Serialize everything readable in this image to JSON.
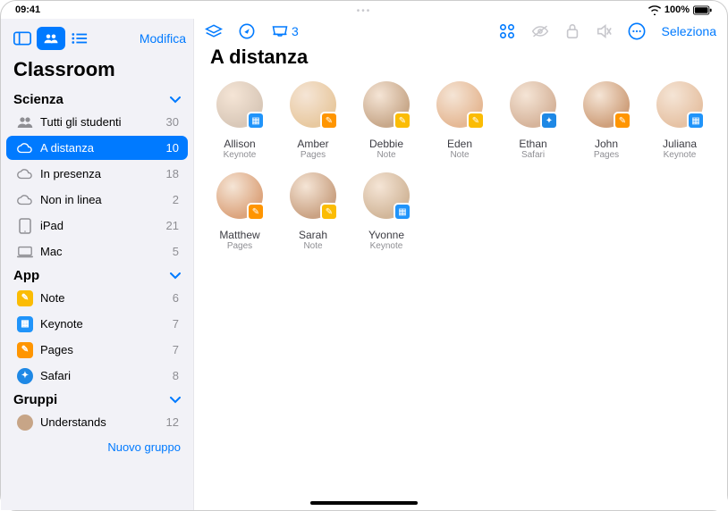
{
  "status": {
    "time": "09:41",
    "battery": "100%"
  },
  "sidebar": {
    "edit_label": "Modifica",
    "title": "Classroom",
    "sections": [
      {
        "header": "Scienza",
        "items": [
          {
            "icon": "people",
            "label": "Tutti gli studenti",
            "count": "30",
            "selected": false
          },
          {
            "icon": "cloud",
            "label": "A distanza",
            "count": "10",
            "selected": true
          },
          {
            "icon": "cloud",
            "label": "In presenza",
            "count": "18",
            "selected": false
          },
          {
            "icon": "cloud",
            "label": "Non in linea",
            "count": "2",
            "selected": false
          },
          {
            "icon": "ipad",
            "label": "iPad",
            "count": "21",
            "selected": false
          },
          {
            "icon": "mac",
            "label": "Mac",
            "count": "5",
            "selected": false
          }
        ]
      },
      {
        "header": "App",
        "items": [
          {
            "icon": "note",
            "label": "Note",
            "count": "6"
          },
          {
            "icon": "keynote",
            "label": "Keynote",
            "count": "7"
          },
          {
            "icon": "pages",
            "label": "Pages",
            "count": "7"
          },
          {
            "icon": "safari",
            "label": "Safari",
            "count": "8"
          }
        ]
      },
      {
        "header": "Gruppi",
        "items": [
          {
            "icon": "group",
            "label": "Understands",
            "count": "12"
          }
        ]
      }
    ],
    "new_group_label": "Nuovo gruppo"
  },
  "main": {
    "title": "A distanza",
    "inbox_count": "3",
    "select_label": "Seleziona",
    "students": [
      {
        "name": "Allison",
        "app": "Keynote",
        "badge": "keynote"
      },
      {
        "name": "Amber",
        "app": "Pages",
        "badge": "pages"
      },
      {
        "name": "Debbie",
        "app": "Note",
        "badge": "note"
      },
      {
        "name": "Eden",
        "app": "Note",
        "badge": "note"
      },
      {
        "name": "Ethan",
        "app": "Safari",
        "badge": "safari"
      },
      {
        "name": "John",
        "app": "Pages",
        "badge": "pages"
      },
      {
        "name": "Juliana",
        "app": "Keynote",
        "badge": "keynote"
      },
      {
        "name": "Matthew",
        "app": "Pages",
        "badge": "pages"
      },
      {
        "name": "Sarah",
        "app": "Note",
        "badge": "note"
      },
      {
        "name": "Yvonne",
        "app": "Keynote",
        "badge": "keynote"
      }
    ]
  }
}
